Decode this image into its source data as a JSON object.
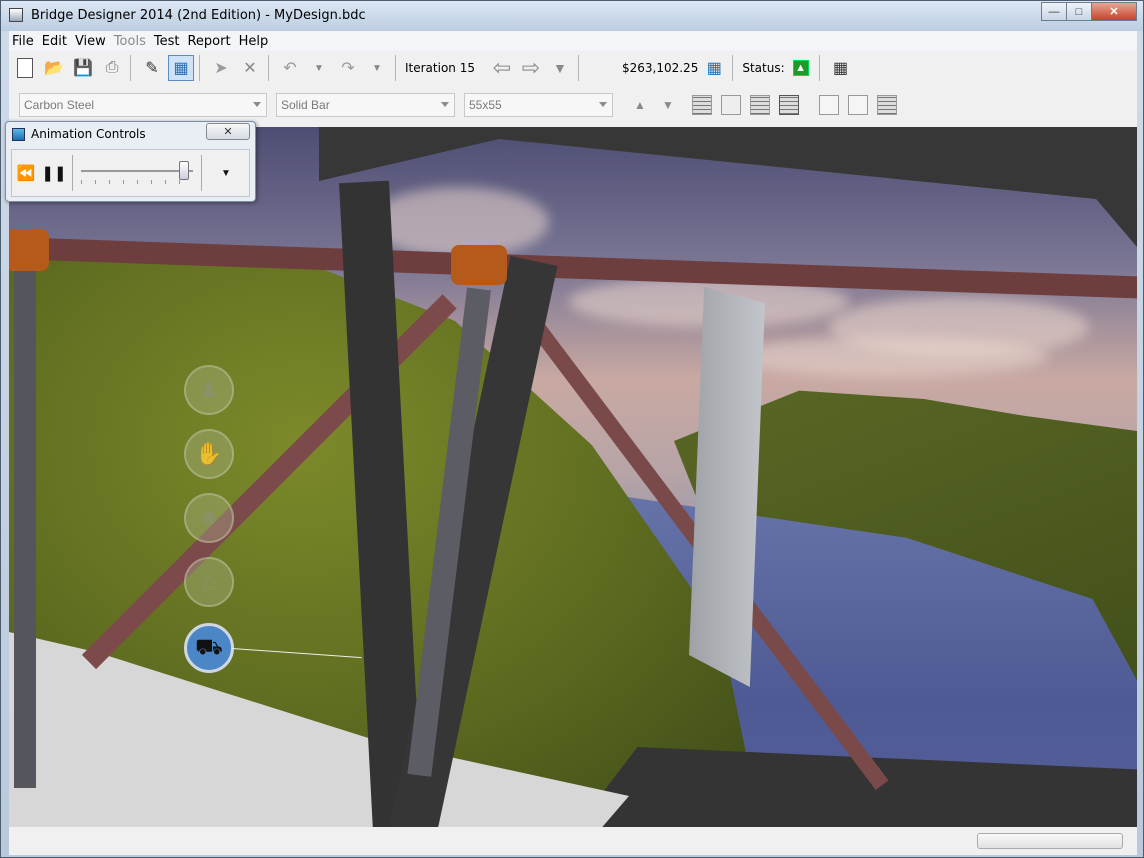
{
  "window": {
    "title": "Bridge Designer 2014 (2nd Edition) - MyDesign.bdc",
    "buttons": [
      "minimize",
      "maximize",
      "close"
    ]
  },
  "menubar": {
    "items": [
      {
        "label": "File",
        "enabled": true
      },
      {
        "label": "Edit",
        "enabled": true
      },
      {
        "label": "View",
        "enabled": true
      },
      {
        "label": "Tools",
        "enabled": false
      },
      {
        "label": "Test",
        "enabled": true
      },
      {
        "label": "Report",
        "enabled": true
      },
      {
        "label": "Help",
        "enabled": true
      }
    ]
  },
  "toolbar": {
    "iteration_label": "Iteration 15",
    "cost": "$263,102.25",
    "status_label": "Status:",
    "status_color": "#1f9a2a",
    "icons": [
      "new-document-icon",
      "open-folder-icon",
      "save-disk-icon",
      "print-icon",
      "drafting-mode-icon",
      "load-test-mode-icon",
      "select-all-icon",
      "delete-icon",
      "undo-icon",
      "redo-icon",
      "iteration-back-icon",
      "iteration-forward-icon",
      "iteration-list-icon",
      "cost-calculator-icon",
      "status-ok-icon",
      "report-table-icon"
    ]
  },
  "member_toolbar": {
    "material": "Carbon Steel",
    "section": "Solid Bar",
    "size": "55x55"
  },
  "animation_controls": {
    "title": "Animation Controls",
    "speed_position": 0.92
  },
  "viewport": {
    "nav_buttons": [
      "walk-icon",
      "hand-pan-icon",
      "head-look-icon",
      "home-icon",
      "truck-icon"
    ],
    "active_nav": "truck-icon"
  }
}
